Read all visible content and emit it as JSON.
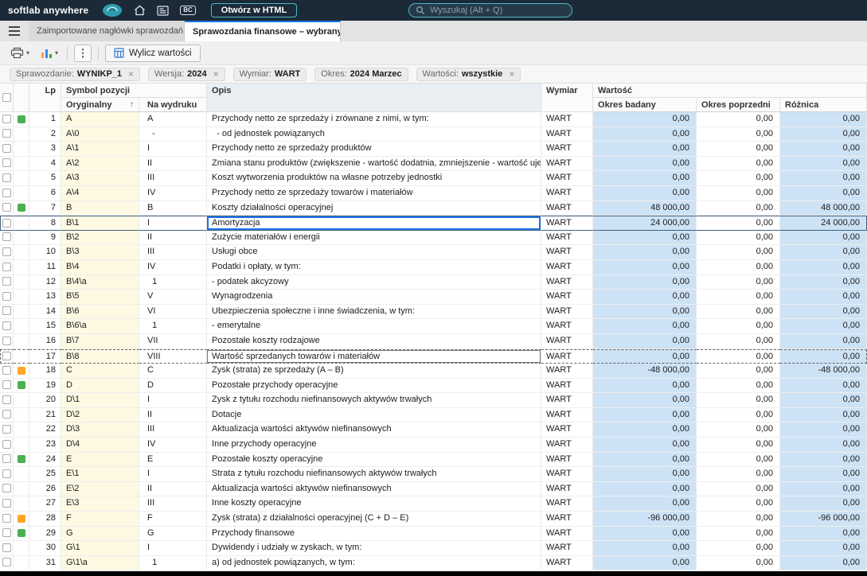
{
  "colors": {
    "topbar_bg": "#1c2a38",
    "accent_teal": "#4fb8c9",
    "selection_blue": "#1a73e8",
    "cell_yellow": "#fdf9e3",
    "cell_blue": "#cde2f5",
    "status_green": "#4caf50",
    "status_orange": "#ffa726"
  },
  "topbar": {
    "brand": "softlab anywhere",
    "bc_badge": "BC",
    "open_html_button": "Otwórz w HTML",
    "search_placeholder": "Wyszukaj (Alt + Q)"
  },
  "tabs": [
    {
      "label": "Zaimportowane nagłówki sprawozdań",
      "active": false
    },
    {
      "label": "Sprawozdania finansowe – wybrany o",
      "active": true
    }
  ],
  "toolbar": {
    "calc_button": "Wylicz wartości"
  },
  "filters": [
    {
      "label": "Sprawozdanie:",
      "value": "WYNIKP_1",
      "closable": true
    },
    {
      "label": "Wersja:",
      "value": "2024",
      "closable": true
    },
    {
      "label": "Wymiar:",
      "value": "WART",
      "closable": false
    },
    {
      "label": "Okres:",
      "value": "2024 Marzec",
      "closable": false
    },
    {
      "label": "Wartości:",
      "value": "wszystkie",
      "closable": true
    }
  ],
  "table": {
    "headers": {
      "lp": "Lp",
      "symbol_group": "Symbol pozycji",
      "original": "Oryginalny",
      "printed": "Na wydruku",
      "description": "Opis",
      "dimension": "Wymiar",
      "value_group": "Wartość",
      "current": "Okres badany",
      "previous": "Okres poprzedni",
      "difference": "Różnica"
    },
    "rows": [
      {
        "lp": 1,
        "symbol": "A",
        "printed": "A",
        "desc": "Przychody netto ze sprzedaży i zrównane z nimi, w tym:",
        "dim": "WART",
        "v1": "0,00",
        "v2": "0,00",
        "v3": "0,00",
        "status": "green"
      },
      {
        "lp": 2,
        "symbol": "A\\0",
        "printed": "  -",
        "desc": "  - od jednostek powiązanych",
        "dim": "WART",
        "v1": "0,00",
        "v2": "0,00",
        "v3": "0,00"
      },
      {
        "lp": 3,
        "symbol": "A\\1",
        "printed": "I",
        "desc": "Przychody netto ze sprzedaży produktów",
        "dim": "WART",
        "v1": "0,00",
        "v2": "0,00",
        "v3": "0,00"
      },
      {
        "lp": 4,
        "symbol": "A\\2",
        "printed": "II",
        "desc": "Zmiana stanu produktów (zwiększenie - wartość dodatnia, zmniejszenie - wartość ujemna)",
        "dim": "WART",
        "v1": "0,00",
        "v2": "0,00",
        "v3": "0,00"
      },
      {
        "lp": 5,
        "symbol": "A\\3",
        "printed": "III",
        "desc": "Koszt wytworzenia produktów na własne potrzeby jednostki",
        "dim": "WART",
        "v1": "0,00",
        "v2": "0,00",
        "v3": "0,00"
      },
      {
        "lp": 6,
        "symbol": "A\\4",
        "printed": "IV",
        "desc": "Przychody netto ze sprzedaży towarów i materiałów",
        "dim": "WART",
        "v1": "0,00",
        "v2": "0,00",
        "v3": "0,00"
      },
      {
        "lp": 7,
        "symbol": "B",
        "printed": "B",
        "desc": "Koszty działalności operacyjnej",
        "dim": "WART",
        "v1": "48 000,00",
        "v2": "0,00",
        "v3": "48 000,00",
        "status": "green"
      },
      {
        "lp": 8,
        "symbol": "B\\1",
        "printed": "I",
        "desc": "Amortyzacja",
        "dim": "WART",
        "v1": "24 000,00",
        "v2": "0,00",
        "v3": "24 000,00",
        "selected": true
      },
      {
        "lp": 9,
        "symbol": "B\\2",
        "printed": "II",
        "desc": "Zużycie materiałów i energii",
        "dim": "WART",
        "v1": "0,00",
        "v2": "0,00",
        "v3": "0,00"
      },
      {
        "lp": 10,
        "symbol": "B\\3",
        "printed": "III",
        "desc": "Usługi obce",
        "dim": "WART",
        "v1": "0,00",
        "v2": "0,00",
        "v3": "0,00"
      },
      {
        "lp": 11,
        "symbol": "B\\4",
        "printed": "IV",
        "desc": "Podatki i opłaty, w tym:",
        "dim": "WART",
        "v1": "0,00",
        "v2": "0,00",
        "v3": "0,00"
      },
      {
        "lp": 12,
        "symbol": "B\\4\\a",
        "printed": "  1",
        "desc": "- podatek akcyzowy",
        "dim": "WART",
        "v1": "0,00",
        "v2": "0,00",
        "v3": "0,00"
      },
      {
        "lp": 13,
        "symbol": "B\\5",
        "printed": "V",
        "desc": "Wynagrodzenia",
        "dim": "WART",
        "v1": "0,00",
        "v2": "0,00",
        "v3": "0,00"
      },
      {
        "lp": 14,
        "symbol": "B\\6",
        "printed": "VI",
        "desc": "Ubezpieczenia społeczne i inne świadczenia, w tym:",
        "dim": "WART",
        "v1": "0,00",
        "v2": "0,00",
        "v3": "0,00"
      },
      {
        "lp": 15,
        "symbol": "B\\6\\a",
        "printed": "  1",
        "desc": "- emerytalne",
        "dim": "WART",
        "v1": "0,00",
        "v2": "0,00",
        "v3": "0,00"
      },
      {
        "lp": 16,
        "symbol": "B\\7",
        "printed": "VII",
        "desc": "Pozostałe koszty rodzajowe",
        "dim": "WART",
        "v1": "0,00",
        "v2": "0,00",
        "v3": "0,00"
      },
      {
        "lp": 17,
        "symbol": "B\\8",
        "printed": "VIII",
        "desc": "Wartość sprzedanych towarów i materiałów",
        "dim": "WART",
        "v1": "0,00",
        "v2": "0,00",
        "v3": "0,00",
        "dashed": true
      },
      {
        "lp": 18,
        "symbol": "C",
        "printed": "C",
        "desc": "Zysk (strata) ze sprzedaży (A – B)",
        "dim": "WART",
        "v1": "-48 000,00",
        "v2": "0,00",
        "v3": "-48 000,00",
        "status": "orange"
      },
      {
        "lp": 19,
        "symbol": "D",
        "printed": "D",
        "desc": "Pozostałe przychody operacyjne",
        "dim": "WART",
        "v1": "0,00",
        "v2": "0,00",
        "v3": "0,00",
        "status": "green"
      },
      {
        "lp": 20,
        "symbol": "D\\1",
        "printed": "I",
        "desc": "Zysk z tytułu rozchodu niefinansowych aktywów trwałych",
        "dim": "WART",
        "v1": "0,00",
        "v2": "0,00",
        "v3": "0,00"
      },
      {
        "lp": 21,
        "symbol": "D\\2",
        "printed": "II",
        "desc": "Dotacje",
        "dim": "WART",
        "v1": "0,00",
        "v2": "0,00",
        "v3": "0,00"
      },
      {
        "lp": 22,
        "symbol": "D\\3",
        "printed": "III",
        "desc": "Aktualizacja wartości aktywów niefinansowych",
        "dim": "WART",
        "v1": "0,00",
        "v2": "0,00",
        "v3": "0,00"
      },
      {
        "lp": 23,
        "symbol": "D\\4",
        "printed": "IV",
        "desc": "Inne przychody operacyjne",
        "dim": "WART",
        "v1": "0,00",
        "v2": "0,00",
        "v3": "0,00"
      },
      {
        "lp": 24,
        "symbol": "E",
        "printed": "E",
        "desc": "Pozostałe koszty operacyjne",
        "dim": "WART",
        "v1": "0,00",
        "v2": "0,00",
        "v3": "0,00",
        "status": "green"
      },
      {
        "lp": 25,
        "symbol": "E\\1",
        "printed": "I",
        "desc": "Strata z tytułu rozchodu niefinansowych aktywów trwałych",
        "dim": "WART",
        "v1": "0,00",
        "v2": "0,00",
        "v3": "0,00"
      },
      {
        "lp": 26,
        "symbol": "E\\2",
        "printed": "II",
        "desc": "Aktualizacja wartości aktywów niefinansowych",
        "dim": "WART",
        "v1": "0,00",
        "v2": "0,00",
        "v3": "0,00"
      },
      {
        "lp": 27,
        "symbol": "E\\3",
        "printed": "III",
        "desc": "Inne koszty operacyjne",
        "dim": "WART",
        "v1": "0,00",
        "v2": "0,00",
        "v3": "0,00"
      },
      {
        "lp": 28,
        "symbol": "F",
        "printed": "F",
        "desc": "Zysk (strata) z działalności operacyjnej (C + D – E)",
        "dim": "WART",
        "v1": "-96 000,00",
        "v2": "0,00",
        "v3": "-96 000,00",
        "status": "orange"
      },
      {
        "lp": 29,
        "symbol": "G",
        "printed": "G",
        "desc": "Przychody finansowe",
        "dim": "WART",
        "v1": "0,00",
        "v2": "0,00",
        "v3": "0,00",
        "status": "green"
      },
      {
        "lp": 30,
        "symbol": "G\\1",
        "printed": "I",
        "desc": "Dywidendy i udziały w zyskach, w tym:",
        "dim": "WART",
        "v1": "0,00",
        "v2": "0,00",
        "v3": "0,00"
      },
      {
        "lp": 31,
        "symbol": "G\\1\\a",
        "printed": "  1",
        "desc": "a) od jednostek powiązanych, w tym:",
        "dim": "WART",
        "v1": "0,00",
        "v2": "0,00",
        "v3": "0,00"
      }
    ]
  }
}
